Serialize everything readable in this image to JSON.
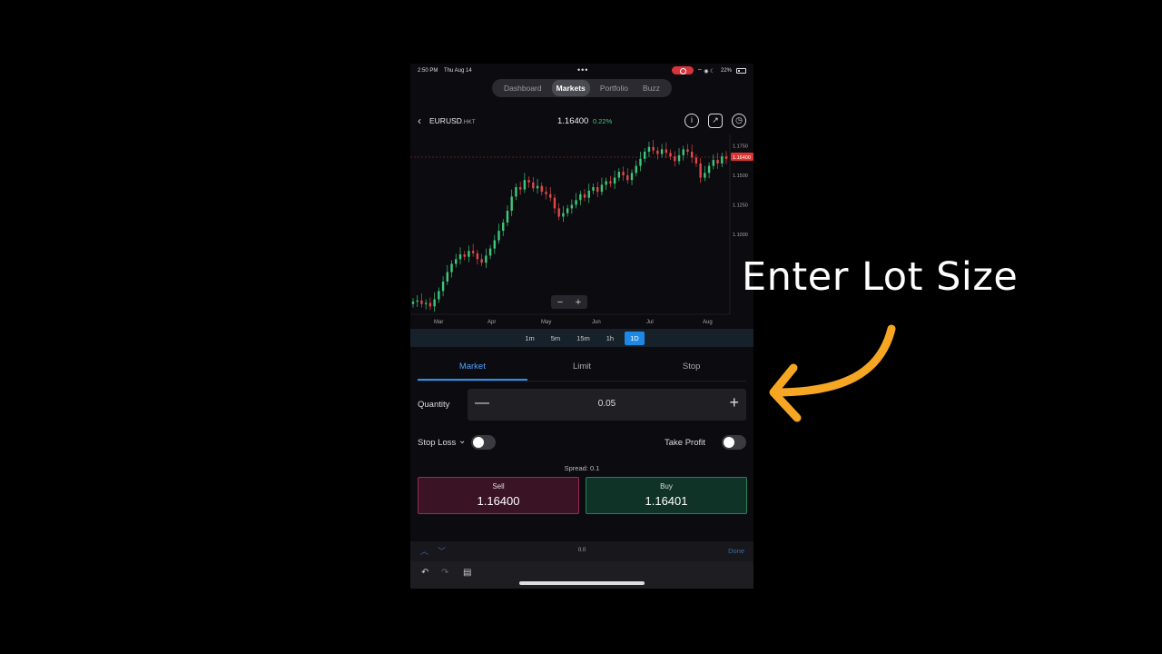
{
  "status_bar": {
    "time": "2:50 PM",
    "date": "Thu Aug 14",
    "battery": "22%"
  },
  "nav": {
    "tabs": [
      "Dashboard",
      "Markets",
      "Portfolio",
      "Buzz"
    ],
    "active_tab": "Markets"
  },
  "instrument": {
    "symbol": "EURUSD",
    "suffix": ".HKT",
    "price": "1.16400",
    "change": "0.22%"
  },
  "chart": {
    "y_ticks": [
      "1.1750",
      "1.1500",
      "1.1250",
      "1.1000"
    ],
    "x_ticks": [
      "Mar",
      "Apr",
      "May",
      "Jun",
      "Jul",
      "Aug"
    ],
    "current_price_label": "1.16400"
  },
  "chart_data": {
    "type": "candlestick",
    "x_ticks": [
      "Mar",
      "Apr",
      "May",
      "Jun",
      "Jul",
      "Aug"
    ],
    "y_ticks": [
      1.175,
      1.15,
      1.125,
      1.1
    ],
    "ylim": [
      1.04,
      1.18
    ],
    "closes": [
      1.043,
      1.044,
      1.041,
      1.042,
      1.039,
      1.045,
      1.052,
      1.06,
      1.068,
      1.075,
      1.079,
      1.083,
      1.081,
      1.086,
      1.084,
      1.079,
      1.076,
      1.082,
      1.088,
      1.095,
      1.103,
      1.11,
      1.12,
      1.132,
      1.14,
      1.138,
      1.146,
      1.144,
      1.139,
      1.141,
      1.136,
      1.134,
      1.131,
      1.122,
      1.115,
      1.118,
      1.122,
      1.125,
      1.129,
      1.134,
      1.131,
      1.137,
      1.14,
      1.136,
      1.142,
      1.145,
      1.143,
      1.148,
      1.153,
      1.15,
      1.146,
      1.152,
      1.158,
      1.164,
      1.17,
      1.174,
      1.171,
      1.168,
      1.172,
      1.169,
      1.166,
      1.162,
      1.167,
      1.172,
      1.17,
      1.165,
      1.16,
      1.148,
      1.152,
      1.158,
      1.163,
      1.16,
      1.166,
      1.164
    ],
    "current_price": 1.164
  },
  "timeframes": [
    "1m",
    "5m",
    "15m",
    "1h",
    "1D"
  ],
  "active_timeframe": "1D",
  "order_tabs": [
    "Market",
    "Limit",
    "Stop"
  ],
  "active_order_tab": "Market",
  "order": {
    "quantity_label": "Quantity",
    "quantity": "0.05",
    "stop_loss_label": "Stop Loss",
    "take_profit_label": "Take Profit",
    "spread": "Spread: 0.1",
    "sell_label": "Sell",
    "sell_price": "1.16400",
    "buy_label": "Buy",
    "buy_price": "1.16401"
  },
  "keyboard": {
    "value": "0.0",
    "done_label": "Done"
  },
  "overlay": {
    "caption": "Enter Lot Size",
    "arrow_color": "#f5a623"
  },
  "colors": {
    "up": "#3cc97a",
    "down": "#e04848",
    "accent": "#1e88e5"
  }
}
